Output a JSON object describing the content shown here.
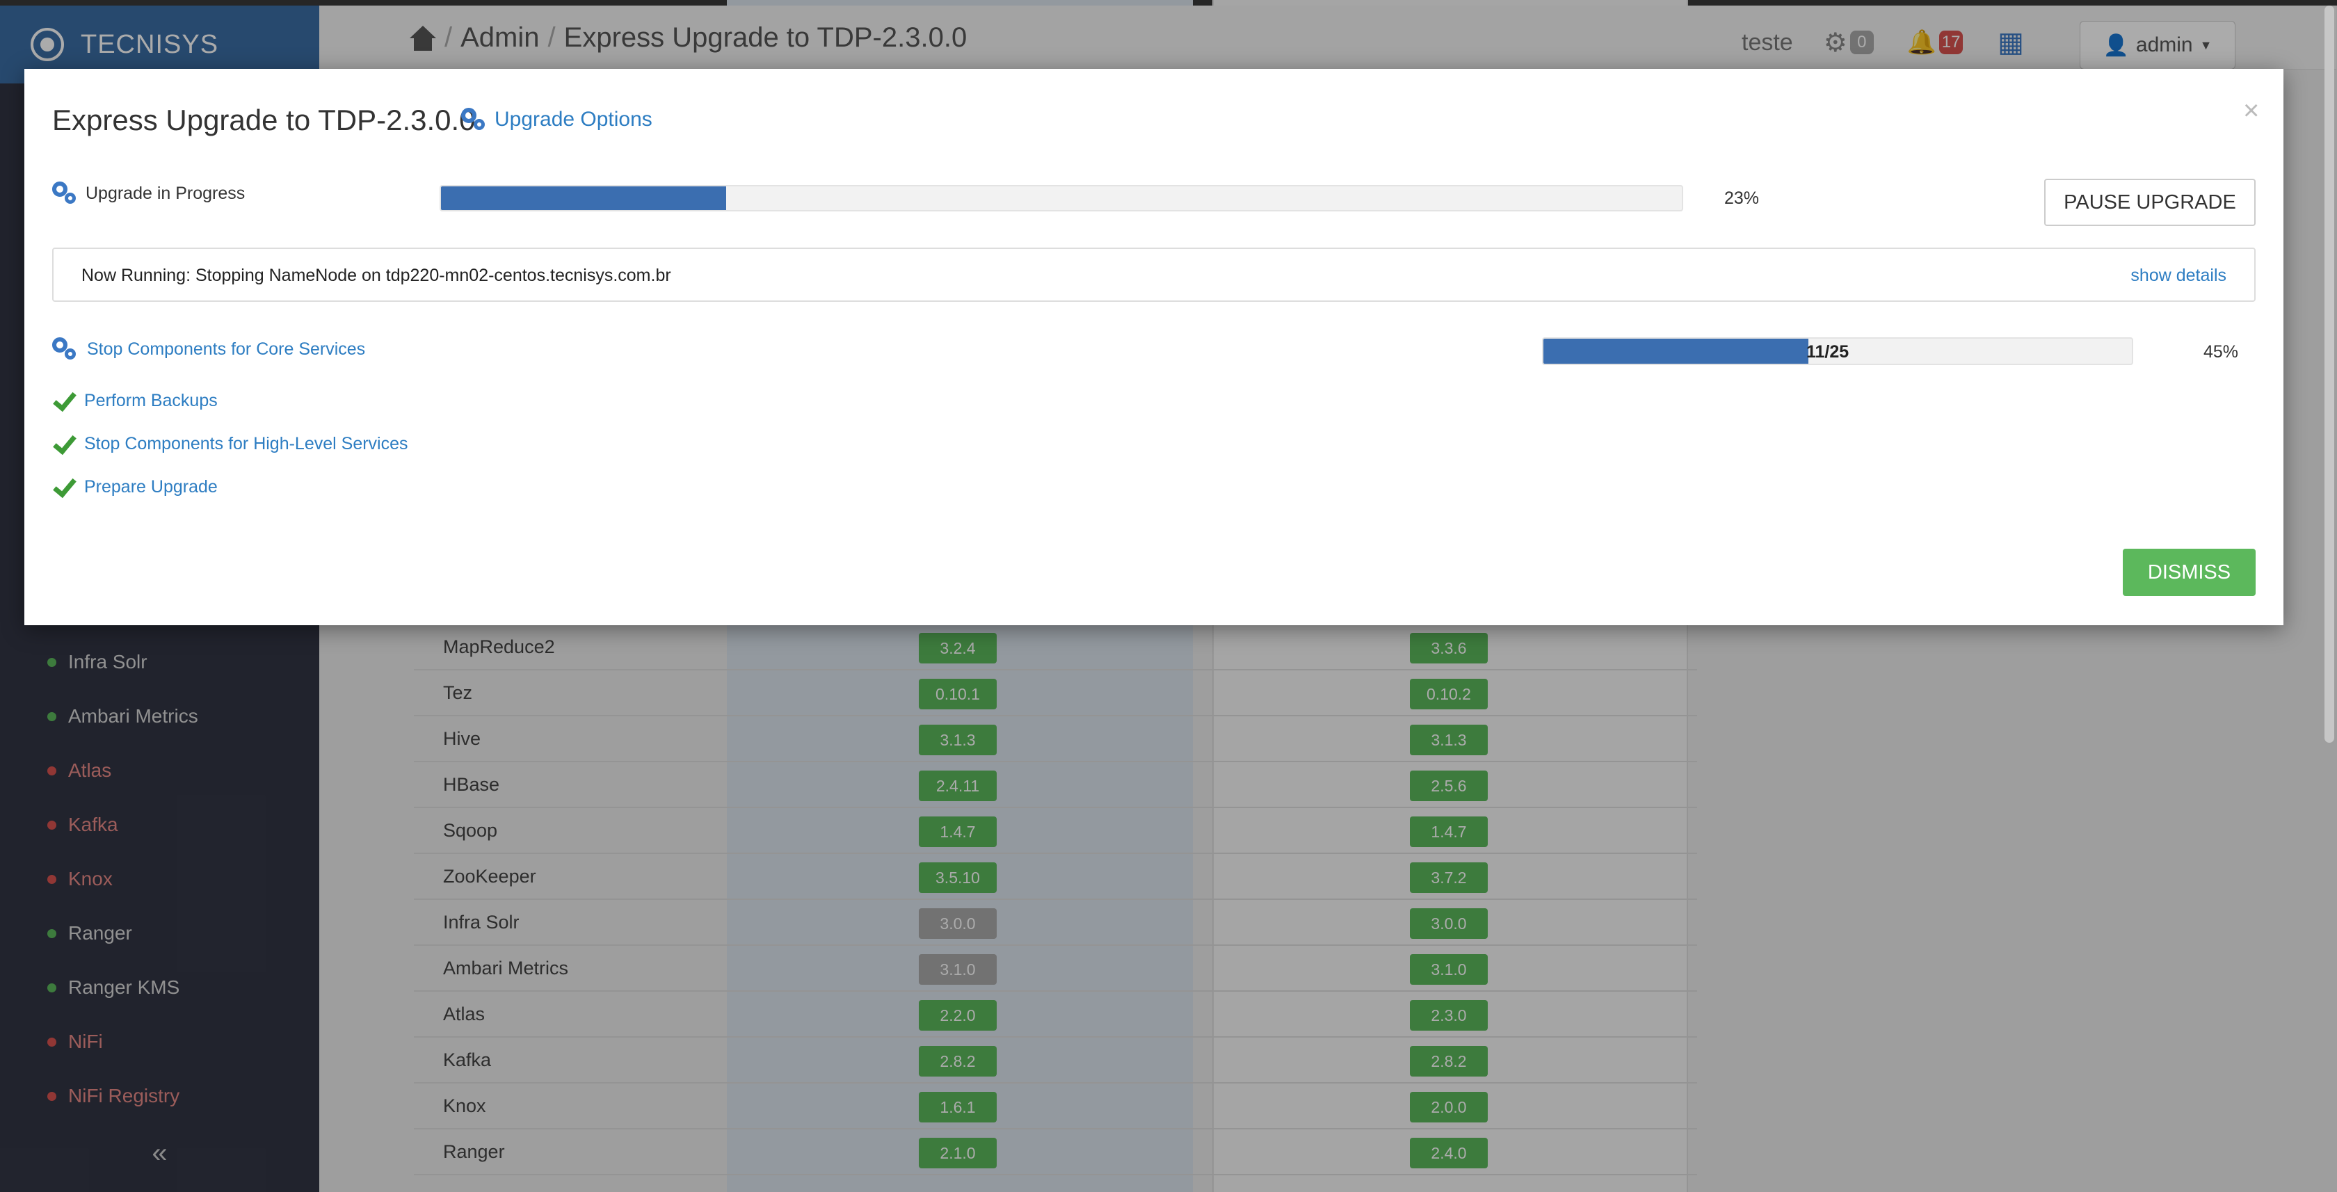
{
  "app": {
    "brand": "TECNISYS"
  },
  "header": {
    "breadcrumb": [
      "Admin",
      "Express Upgrade to TDP-2.3.0.0"
    ],
    "separator": "/",
    "cluster": "teste",
    "ops_count": "0",
    "alerts_count": "17",
    "user": "admin"
  },
  "sidebar": {
    "items": [
      {
        "label": "Infra Solr",
        "status": "green"
      },
      {
        "label": "Ambari Metrics",
        "status": "green"
      },
      {
        "label": "Atlas",
        "status": "red"
      },
      {
        "label": "Kafka",
        "status": "red"
      },
      {
        "label": "Knox",
        "status": "red"
      },
      {
        "label": "Ranger",
        "status": "green"
      },
      {
        "label": "Ranger KMS",
        "status": "green"
      },
      {
        "label": "NiFi",
        "status": "red"
      },
      {
        "label": "NiFi Registry",
        "status": "red"
      }
    ],
    "collapse": "«"
  },
  "versions": [
    {
      "service": "MapReduce2",
      "current": "3.2.4",
      "target": "3.3.6",
      "current_grey": false
    },
    {
      "service": "Tez",
      "current": "0.10.1",
      "target": "0.10.2",
      "current_grey": false
    },
    {
      "service": "Hive",
      "current": "3.1.3",
      "target": "3.1.3",
      "current_grey": false
    },
    {
      "service": "HBase",
      "current": "2.4.11",
      "target": "2.5.6",
      "current_grey": false
    },
    {
      "service": "Sqoop",
      "current": "1.4.7",
      "target": "1.4.7",
      "current_grey": false
    },
    {
      "service": "ZooKeeper",
      "current": "3.5.10",
      "target": "3.7.2",
      "current_grey": false
    },
    {
      "service": "Infra Solr",
      "current": "3.0.0",
      "target": "3.0.0",
      "current_grey": true
    },
    {
      "service": "Ambari Metrics",
      "current": "3.1.0",
      "target": "3.1.0",
      "current_grey": true
    },
    {
      "service": "Atlas",
      "current": "2.2.0",
      "target": "2.3.0",
      "current_grey": false
    },
    {
      "service": "Kafka",
      "current": "2.8.2",
      "target": "2.8.2",
      "current_grey": false
    },
    {
      "service": "Knox",
      "current": "1.6.1",
      "target": "2.0.0",
      "current_grey": false
    },
    {
      "service": "Ranger",
      "current": "2.1.0",
      "target": "2.4.0",
      "current_grey": false
    }
  ],
  "modal": {
    "title": "Express Upgrade to TDP-2.3.0.0",
    "options_label": "Upgrade Options",
    "close": "×",
    "status_label": "Upgrade in Progress",
    "progress": 0.23,
    "progress_text": "23%",
    "pause_label": "PAUSE UPGRADE",
    "now_running": "Now Running: Stopping NameNode on tdp220-mn02-centos.tecnisys.com.br",
    "show_details": "show details",
    "current_task": {
      "label": "Stop Components for Core Services",
      "count_text": "11/25",
      "progress": 0.45,
      "progress_text": "45%"
    },
    "completed_tasks": [
      "Perform Backups",
      "Stop Components for High-Level Services",
      "Prepare Upgrade"
    ],
    "dismiss_label": "DISMISS"
  },
  "colors": {
    "accent": "#3b6eb0",
    "link": "#2d7dc2",
    "success": "#5cb85c",
    "alert": "#d9534f"
  }
}
